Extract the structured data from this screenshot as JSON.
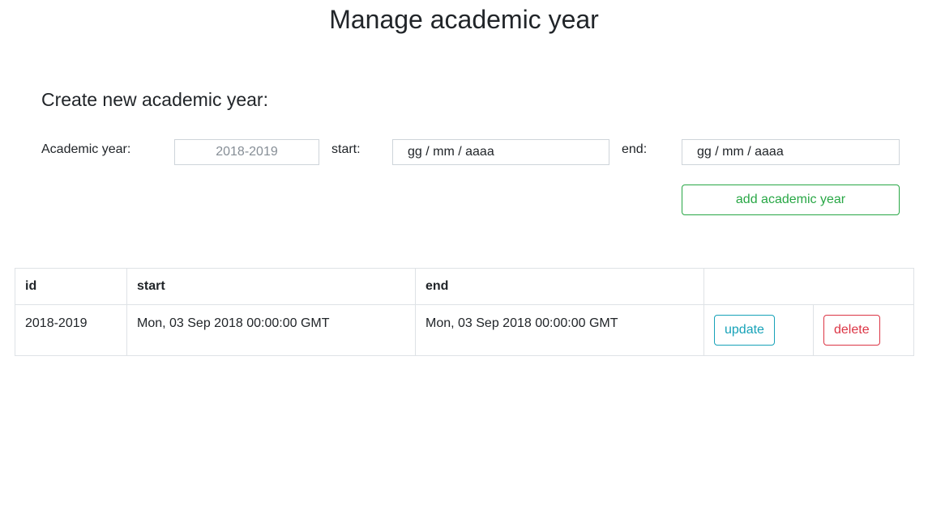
{
  "page": {
    "title": "Manage academic year"
  },
  "form": {
    "heading": "Create new academic year:",
    "year_label": "Academic year:",
    "year_placeholder": "2018-2019",
    "year_value": "",
    "start_label": "start:",
    "start_value": "gg / mm / aaaa",
    "end_label": "end:",
    "end_value": "gg / mm / aaaa",
    "submit_label": "add academic year"
  },
  "table": {
    "headers": [
      "id",
      "start",
      "end",
      ""
    ],
    "rows": [
      {
        "id": "2018-2019",
        "start": "Mon, 03 Sep 2018 00:00:00 GMT",
        "end": "Mon, 03 Sep 2018 00:00:00 GMT",
        "update_label": "update",
        "delete_label": "delete"
      }
    ]
  },
  "colors": {
    "success": "#28a745",
    "info": "#17a2b8",
    "danger": "#dc3545",
    "border": "#dee2e6",
    "text": "#212529"
  }
}
